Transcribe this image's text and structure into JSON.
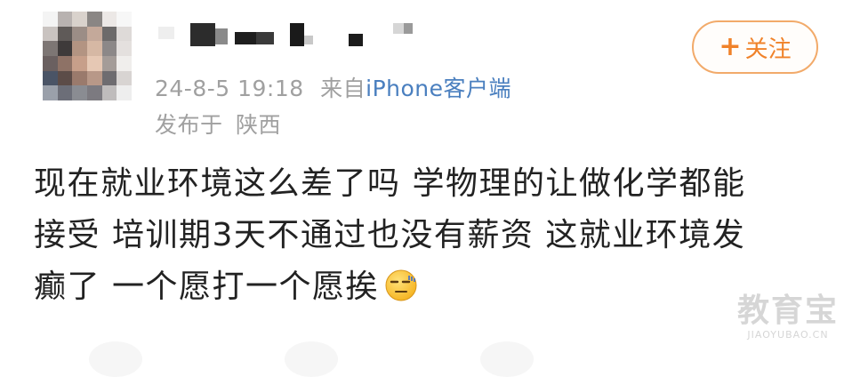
{
  "post": {
    "username_hidden": true,
    "time": "24-8-5 19:18",
    "source_prefix": "来自",
    "source_name": "iPhone客户端",
    "location_prefix": "发布于",
    "location": "陕西",
    "follow_plus": "+",
    "follow_label": "关注",
    "content_lines": [
      "现在就业环境这么差了吗 学物理的让做化学都能",
      "接受 培训期3天不通过也没有薪资 这就业环境发",
      "癫了 一个愿打一个愿挨"
    ],
    "emoji": "speechless-face-emoji"
  },
  "watermark": {
    "main": "教育宝",
    "sub": "JIAOYUBAO.CN"
  },
  "colors": {
    "accent_orange": "#f0822a",
    "source_blue": "#4a7fbf",
    "meta_gray": "#a0a0a0",
    "text": "#222222"
  }
}
